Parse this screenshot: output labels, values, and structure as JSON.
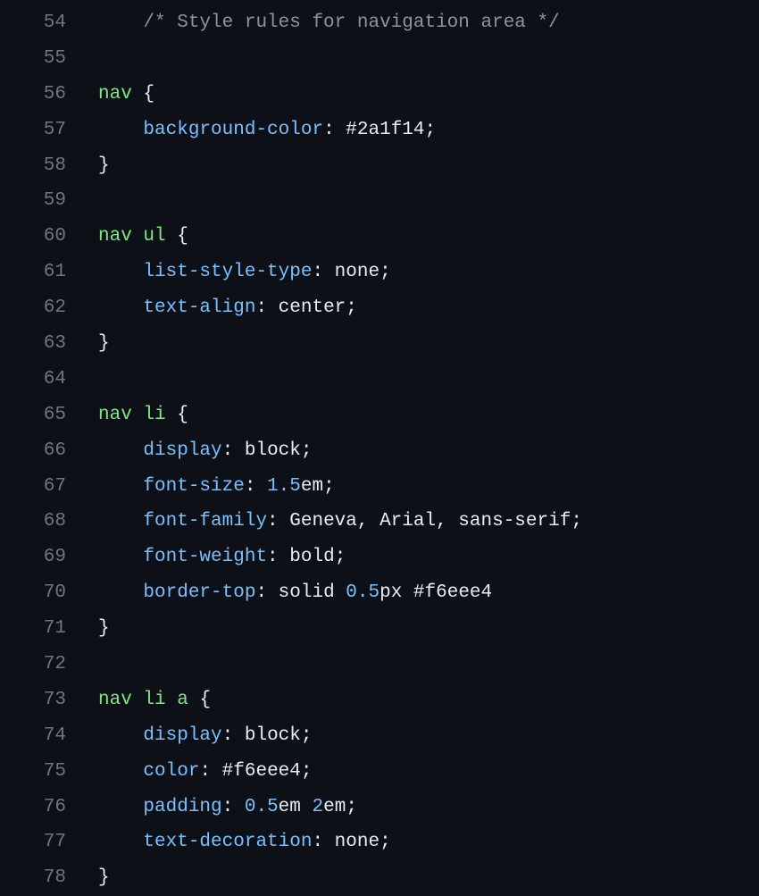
{
  "lines": [
    {
      "num": "54",
      "tokens": [
        {
          "t": "    ",
          "c": "punct"
        },
        {
          "t": "/* Style rules for navigation area */",
          "c": "comment"
        }
      ]
    },
    {
      "num": "55",
      "tokens": []
    },
    {
      "num": "56",
      "tokens": [
        {
          "t": "nav",
          "c": "selector"
        },
        {
          "t": " ",
          "c": "punct"
        },
        {
          "t": "{",
          "c": "brace"
        }
      ]
    },
    {
      "num": "57",
      "tokens": [
        {
          "t": "    ",
          "c": "punct"
        },
        {
          "t": "background-color",
          "c": "property"
        },
        {
          "t": ": ",
          "c": "punct"
        },
        {
          "t": "#2a1f14",
          "c": "value"
        },
        {
          "t": ";",
          "c": "punct"
        }
      ]
    },
    {
      "num": "58",
      "tokens": [
        {
          "t": "}",
          "c": "brace"
        }
      ]
    },
    {
      "num": "59",
      "tokens": []
    },
    {
      "num": "60",
      "tokens": [
        {
          "t": "nav",
          "c": "selector"
        },
        {
          "t": " ",
          "c": "punct"
        },
        {
          "t": "ul",
          "c": "selector"
        },
        {
          "t": " ",
          "c": "punct"
        },
        {
          "t": "{",
          "c": "brace"
        }
      ]
    },
    {
      "num": "61",
      "tokens": [
        {
          "t": "    ",
          "c": "punct"
        },
        {
          "t": "list-style-type",
          "c": "property"
        },
        {
          "t": ": ",
          "c": "punct"
        },
        {
          "t": "none",
          "c": "value"
        },
        {
          "t": ";",
          "c": "punct"
        }
      ]
    },
    {
      "num": "62",
      "tokens": [
        {
          "t": "    ",
          "c": "punct"
        },
        {
          "t": "text-align",
          "c": "property"
        },
        {
          "t": ": ",
          "c": "punct"
        },
        {
          "t": "center",
          "c": "value"
        },
        {
          "t": ";",
          "c": "punct"
        }
      ]
    },
    {
      "num": "63",
      "tokens": [
        {
          "t": "}",
          "c": "brace"
        }
      ]
    },
    {
      "num": "64",
      "tokens": []
    },
    {
      "num": "65",
      "tokens": [
        {
          "t": "nav",
          "c": "selector"
        },
        {
          "t": " ",
          "c": "punct"
        },
        {
          "t": "li",
          "c": "selector"
        },
        {
          "t": " ",
          "c": "punct"
        },
        {
          "t": "{",
          "c": "brace"
        }
      ]
    },
    {
      "num": "66",
      "tokens": [
        {
          "t": "    ",
          "c": "punct"
        },
        {
          "t": "display",
          "c": "property"
        },
        {
          "t": ": ",
          "c": "punct"
        },
        {
          "t": "block",
          "c": "value"
        },
        {
          "t": ";",
          "c": "punct"
        }
      ]
    },
    {
      "num": "67",
      "tokens": [
        {
          "t": "    ",
          "c": "punct"
        },
        {
          "t": "font-size",
          "c": "property"
        },
        {
          "t": ": ",
          "c": "punct"
        },
        {
          "t": "1.5",
          "c": "number"
        },
        {
          "t": "em",
          "c": "unit"
        },
        {
          "t": ";",
          "c": "punct"
        }
      ]
    },
    {
      "num": "68",
      "tokens": [
        {
          "t": "    ",
          "c": "punct"
        },
        {
          "t": "font-family",
          "c": "property"
        },
        {
          "t": ": ",
          "c": "punct"
        },
        {
          "t": "Geneva, Arial, sans-serif",
          "c": "value"
        },
        {
          "t": ";",
          "c": "punct"
        }
      ]
    },
    {
      "num": "69",
      "tokens": [
        {
          "t": "    ",
          "c": "punct"
        },
        {
          "t": "font-weight",
          "c": "property"
        },
        {
          "t": ": ",
          "c": "punct"
        },
        {
          "t": "bold",
          "c": "value"
        },
        {
          "t": ";",
          "c": "punct"
        }
      ]
    },
    {
      "num": "70",
      "tokens": [
        {
          "t": "    ",
          "c": "punct"
        },
        {
          "t": "border-top",
          "c": "property"
        },
        {
          "t": ": ",
          "c": "punct"
        },
        {
          "t": "solid ",
          "c": "value"
        },
        {
          "t": "0.5",
          "c": "number"
        },
        {
          "t": "px ",
          "c": "unit"
        },
        {
          "t": "#f6eee4",
          "c": "value"
        }
      ]
    },
    {
      "num": "71",
      "tokens": [
        {
          "t": "}",
          "c": "brace"
        }
      ]
    },
    {
      "num": "72",
      "tokens": []
    },
    {
      "num": "73",
      "tokens": [
        {
          "t": "nav",
          "c": "selector"
        },
        {
          "t": " ",
          "c": "punct"
        },
        {
          "t": "li",
          "c": "selector"
        },
        {
          "t": " ",
          "c": "punct"
        },
        {
          "t": "a",
          "c": "selector"
        },
        {
          "t": " ",
          "c": "punct"
        },
        {
          "t": "{",
          "c": "brace"
        }
      ]
    },
    {
      "num": "74",
      "tokens": [
        {
          "t": "    ",
          "c": "punct"
        },
        {
          "t": "display",
          "c": "property"
        },
        {
          "t": ": ",
          "c": "punct"
        },
        {
          "t": "block",
          "c": "value"
        },
        {
          "t": ";",
          "c": "punct"
        }
      ]
    },
    {
      "num": "75",
      "tokens": [
        {
          "t": "    ",
          "c": "punct"
        },
        {
          "t": "color",
          "c": "property"
        },
        {
          "t": ": ",
          "c": "punct"
        },
        {
          "t": "#f6eee4",
          "c": "value"
        },
        {
          "t": ";",
          "c": "punct"
        }
      ]
    },
    {
      "num": "76",
      "tokens": [
        {
          "t": "    ",
          "c": "punct"
        },
        {
          "t": "padding",
          "c": "property"
        },
        {
          "t": ": ",
          "c": "punct"
        },
        {
          "t": "0.5",
          "c": "number"
        },
        {
          "t": "em ",
          "c": "unit"
        },
        {
          "t": "2",
          "c": "number"
        },
        {
          "t": "em",
          "c": "unit"
        },
        {
          "t": ";",
          "c": "punct"
        }
      ]
    },
    {
      "num": "77",
      "tokens": [
        {
          "t": "    ",
          "c": "punct"
        },
        {
          "t": "text-decoration",
          "c": "property"
        },
        {
          "t": ": ",
          "c": "punct"
        },
        {
          "t": "none",
          "c": "value"
        },
        {
          "t": ";",
          "c": "punct"
        }
      ]
    },
    {
      "num": "78",
      "tokens": [
        {
          "t": "}",
          "c": "brace"
        }
      ]
    }
  ]
}
